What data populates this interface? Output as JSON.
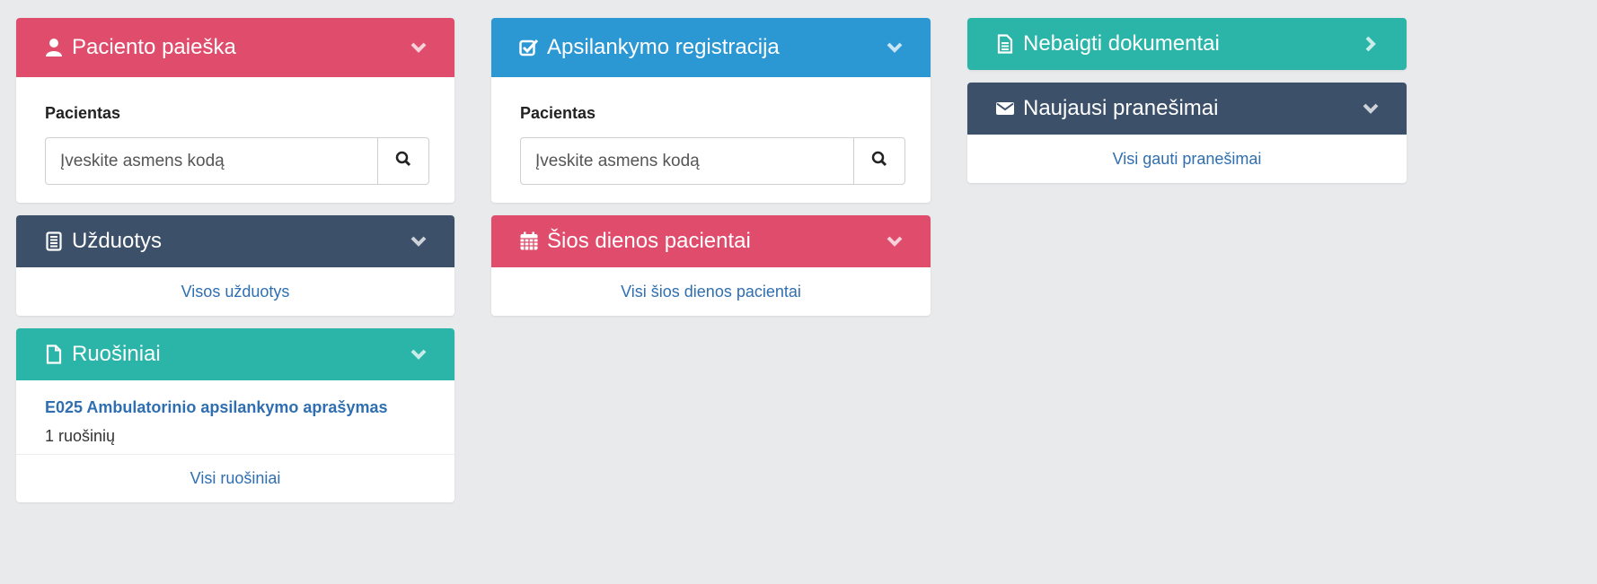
{
  "colors": {
    "red": "#df4c6c",
    "blue": "#2b97d3",
    "teal": "#2bb5a9",
    "navy": "#3c5069",
    "link": "#2f6fb1"
  },
  "patient_search": {
    "icon": "user-icon",
    "title": "Paciento paieška",
    "label": "Pacientas",
    "placeholder": "Įveskite asmens kodą",
    "button_icon": "search-icon"
  },
  "visit_registration": {
    "icon": "checkbox-icon",
    "title": "Apsilankymo registracija",
    "label": "Pacientas",
    "placeholder": "Įveskite asmens kodą",
    "button_icon": "search-icon"
  },
  "unfinished_documents": {
    "icon": "document-icon",
    "title": "Nebaigti dokumentai"
  },
  "latest_messages": {
    "icon": "envelope-icon",
    "title": "Naujausi pranešimai",
    "link": "Visi gauti pranešimai"
  },
  "tasks": {
    "icon": "clipboard-icon",
    "title": "Užduotys",
    "link": "Visos užduotys"
  },
  "todays_patients": {
    "icon": "calendar-icon",
    "title": "Šios dienos pacientai",
    "link": "Visi šios dienos pacientai"
  },
  "drafts": {
    "icon": "file-icon",
    "title": "Ruošiniai",
    "items": [
      {
        "title": "E025 Ambulatorinio apsilankymo aprašymas",
        "count": "1 ruošinių"
      }
    ],
    "link": "Visi ruošiniai"
  }
}
